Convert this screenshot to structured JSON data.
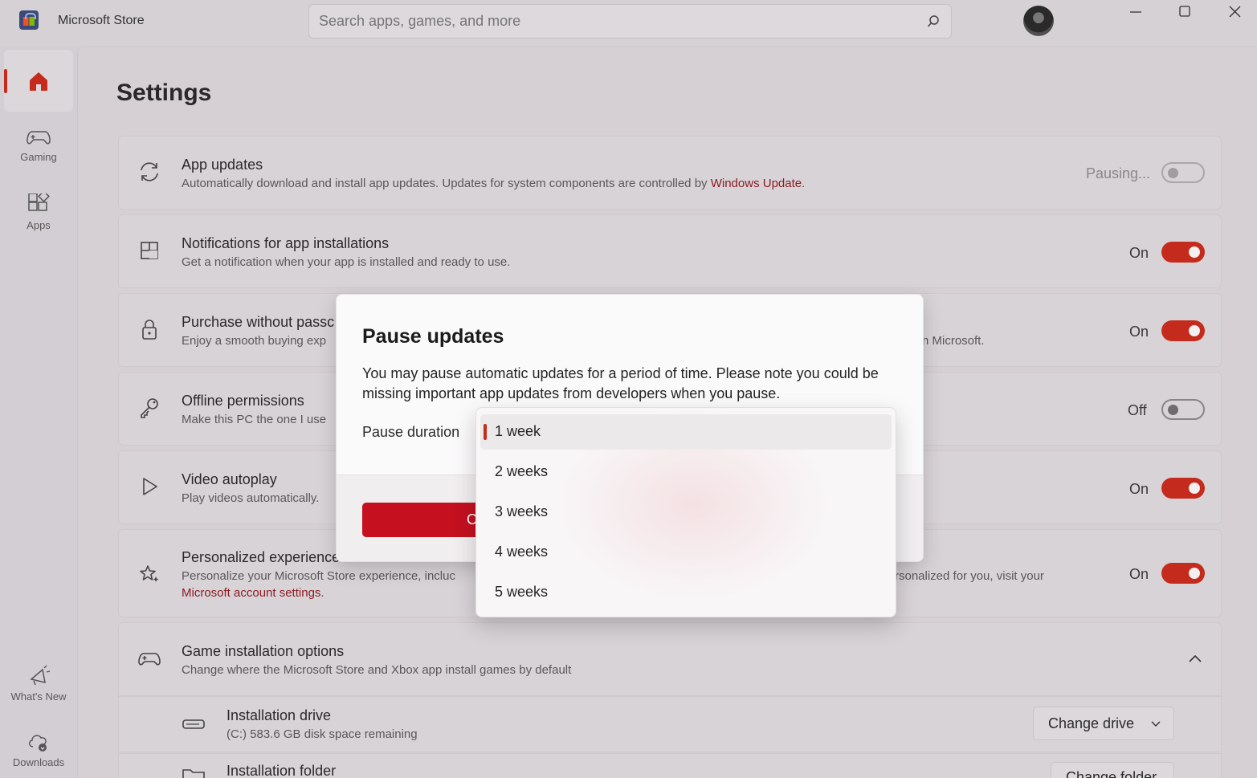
{
  "app": {
    "title": "Microsoft Store"
  },
  "search": {
    "placeholder": "Search apps, games, and more"
  },
  "nav": {
    "items": [
      {
        "label": "Home",
        "icon": "home-icon"
      },
      {
        "label": "Gaming",
        "icon": "gamepad-icon"
      },
      {
        "label": "Apps",
        "icon": "apps-icon"
      },
      {
        "label": "What's New",
        "icon": "megaphone-icon"
      },
      {
        "label": "Downloads",
        "icon": "downloads-icon"
      }
    ]
  },
  "page": {
    "title": "Settings"
  },
  "settings": [
    {
      "title": "App updates",
      "desc": "Automatically download and install app updates. Updates for system components are controlled by ",
      "link": "Windows Update",
      "desc_end": ".",
      "state": "Pausing...",
      "on": false
    },
    {
      "title": "Notifications for app installations",
      "desc": "Get a notification when your app is installed and ready to use.",
      "state": "On",
      "on": true
    },
    {
      "title": "Purchase without passc",
      "desc": "Enjoy a smooth buying exp",
      "desc_tail": "n Microsoft.",
      "state": "On",
      "on": true
    },
    {
      "title": "Offline permissions",
      "desc": "Make this PC the one I use",
      "state": "Off",
      "on": false
    },
    {
      "title": "Video autoplay",
      "desc": "Play videos automatically.",
      "state": "On",
      "on": true
    },
    {
      "title": "Personalized experience",
      "desc": "Personalize your Microsoft Store experience, incluc",
      "desc_tail": "rsonalized for you, visit your",
      "link": "Microsoft account settings",
      "desc_end": ".",
      "state": "On",
      "on": true
    },
    {
      "title": "Game installation options",
      "desc": "Change where the Microsoft Store and Xbox app install games by default"
    }
  ],
  "install": {
    "drive_title": "Installation drive",
    "drive_desc": "(C:) 583.6 GB disk space remaining",
    "drive_button": "Change drive",
    "folder_title": "Installation folder",
    "folder_button": "Change folder"
  },
  "dialog": {
    "title": "Pause updates",
    "text": "You may pause automatic updates for a period of time. Please note you could be missing important app updates from developers when you pause.",
    "label": "Pause duration",
    "primary_partial": "C"
  },
  "dropdown": {
    "selected": "1 week",
    "options": [
      "1 week",
      "2 weeks",
      "3 weeks",
      "4 weeks",
      "5 weeks"
    ]
  },
  "colors": {
    "accent": "#c42b1c",
    "link": "#8b1c24"
  }
}
